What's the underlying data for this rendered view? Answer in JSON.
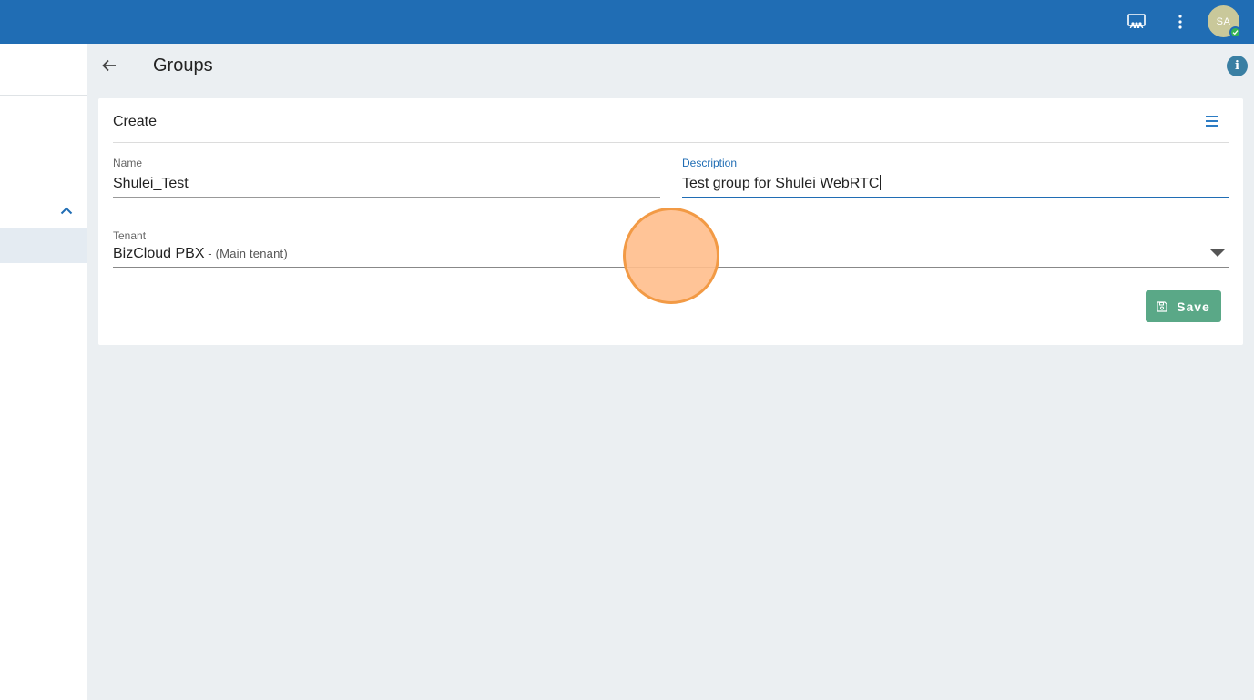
{
  "topbar": {
    "icons": [
      "remote-assist-icon",
      "more-vert-icon"
    ],
    "avatar": {
      "initials": "SA",
      "status_color": "#34b552"
    }
  },
  "header": {
    "title": "Groups"
  },
  "card": {
    "title": "Create",
    "fields": {
      "name": {
        "label": "Name",
        "value": "Shulei_Test"
      },
      "description": {
        "label": "Description",
        "value": "Test group for Shulei WebRTC"
      },
      "tenant": {
        "label": "Tenant",
        "value": "BizCloud PBX",
        "sub": " - (Main tenant)"
      }
    },
    "save_label": "Save"
  },
  "colors": {
    "topbar": "#206db4",
    "save_button": "#5aa887",
    "accent": "#206db4"
  }
}
